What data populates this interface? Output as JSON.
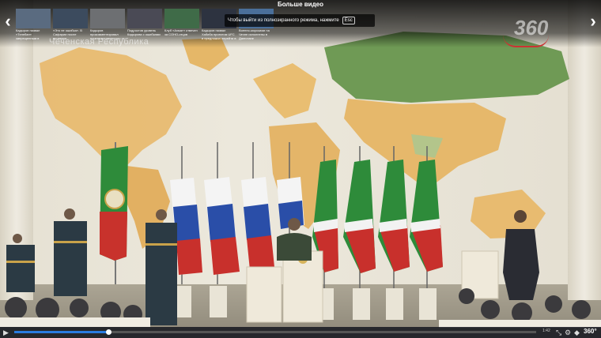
{
  "overlay": {
    "more_videos_title": "Больше видео",
    "fullscreen_hint": "Чтобы выйти из полноэкранного режима, нажмите",
    "esc_key": "Esc",
    "watermark": "Чеченская Республика",
    "logo": "360"
  },
  "thumbnails": [
    {
      "caption": "Кадыров назвал «Телебан» запрещенным в республике",
      "color": "#5a6b80"
    },
    {
      "caption": "«Это не ошибка». В Сафарии после проверки...",
      "color": "#3c4b5e"
    },
    {
      "caption": "Кадыров прокомментировал ничего оставленного от СВО",
      "color": "#6d6f72"
    },
    {
      "caption": "Подростов уровень Кадырова с ошибками",
      "color": "#4a4a55"
    },
    {
      "caption": "Клуб «Ахмат» отвечен за СОНО-отцов",
      "color": "#3f6b48"
    },
    {
      "caption": "Кадыров назвал Хабиба проектом UFC и предложил перейти в «Ахмат»",
      "color": "#2d3340"
    },
    {
      "caption": "Военно-морскими на Чечне исполнены в Дагестане",
      "color": "#4a6f9a"
    }
  ],
  "player": {
    "time": "1:42",
    "badge": "360°",
    "progress": 0.18
  }
}
